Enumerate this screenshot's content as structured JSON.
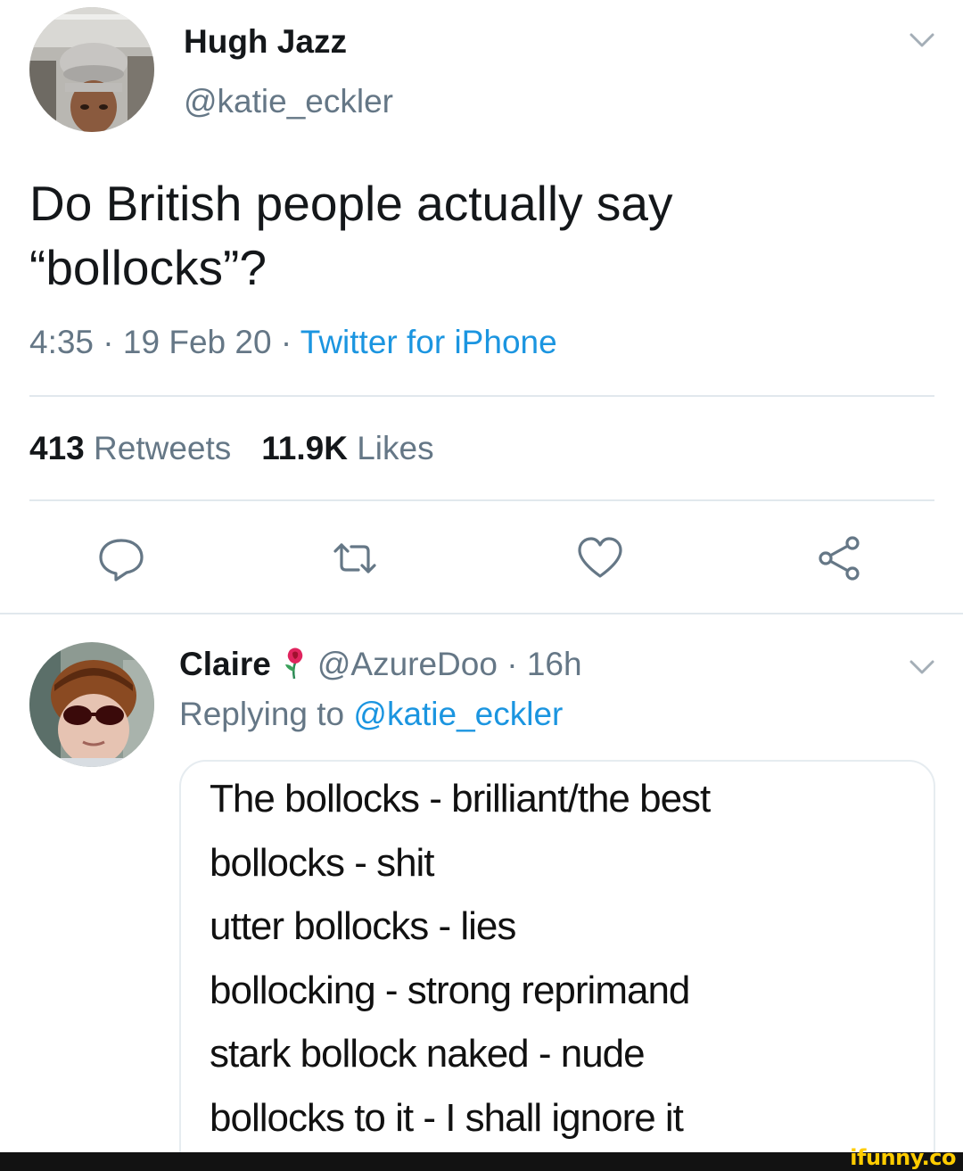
{
  "tweet": {
    "author_name": "Hugh Jazz",
    "author_handle": "@katie_eckler",
    "text": "Do British people actually say “bollocks”?",
    "time": "4:35",
    "date": "19 Feb 20",
    "separator": " · ",
    "source": "Twitter for iPhone",
    "retweets_count": "413",
    "retweets_label": "Retweets",
    "likes_count": "11.9K",
    "likes_label": "Likes",
    "icons": [
      "reply-icon",
      "retweet-icon",
      "heart-icon",
      "share-icon",
      "chevron-down-icon"
    ]
  },
  "reply": {
    "author_name": "Claire",
    "author_handle": "@AzureDoo",
    "separator": " · ",
    "age": "16h",
    "replying_label": "Replying to",
    "replying_handle": "@katie_eckler",
    "media_lines": [
      "The bollocks - brilliant/the best",
      "bollocks - shit",
      "utter bollocks - lies",
      "bollocking - strong reprimand",
      "stark bollock naked - nude",
      "bollocks to it - I shall ignore it"
    ]
  },
  "watermark": "ifunny.co",
  "colors": {
    "text": "#14171a",
    "secondary": "#657786",
    "link": "#1b95e0",
    "divider": "#e1e8ed",
    "watermark": "#ffcc00"
  }
}
